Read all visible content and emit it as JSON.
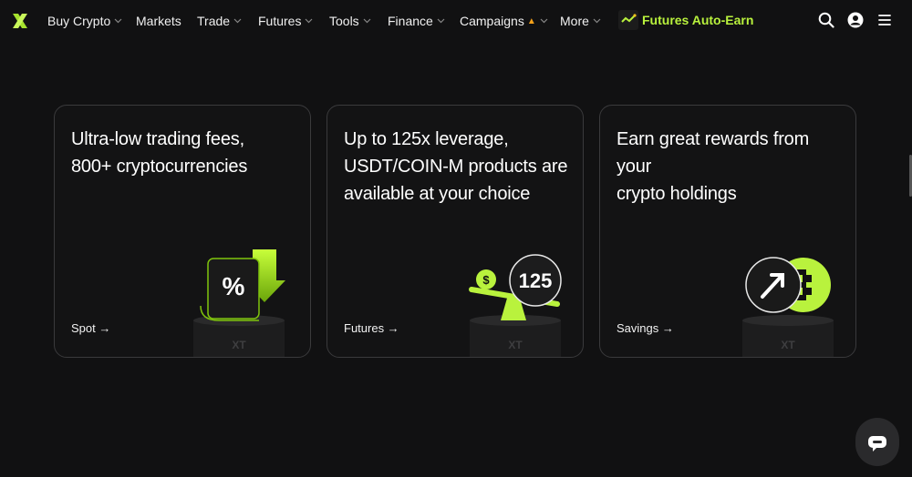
{
  "nav": {
    "logo": "xt-logo-icon",
    "items": [
      {
        "label": "Buy Crypto",
        "dropdown": true
      },
      {
        "label": "Markets",
        "dropdown": false
      },
      {
        "label": "Trade",
        "dropdown": true
      },
      {
        "label": "Futures",
        "dropdown": true
      },
      {
        "label": "Tools",
        "dropdown": true
      },
      {
        "label": "Finance",
        "dropdown": true
      },
      {
        "label": "Campaigns",
        "dropdown": true,
        "badge": "fire-icon"
      },
      {
        "label": "More",
        "dropdown": true
      }
    ],
    "promo_label": "Futures Auto-Earn",
    "right_icons": [
      "search-icon",
      "user-icon",
      "menu-icon"
    ]
  },
  "cards": [
    {
      "title_line1": "Ultra-low trading fees,",
      "title_line2": "800+ cryptocurrencies",
      "title_line3": "",
      "link": "Spot →",
      "pedestal_label": "XT",
      "badge": "%"
    },
    {
      "title_line1": "Up to 125x leverage,",
      "title_line2": "USDT/COIN-M products are",
      "title_line3": "available at your choice",
      "link": "Futures →",
      "pedestal_label": "XT",
      "badge": "125",
      "coin": "$"
    },
    {
      "title_line1": "Earn great rewards from your",
      "title_line2": "crypto holdings",
      "title_line3": "",
      "link": "Savings →",
      "pedestal_label": "XT"
    }
  ],
  "colors": {
    "background": "#111112",
    "accent": "#b9f23d",
    "card_border": "#3a3a3c"
  }
}
